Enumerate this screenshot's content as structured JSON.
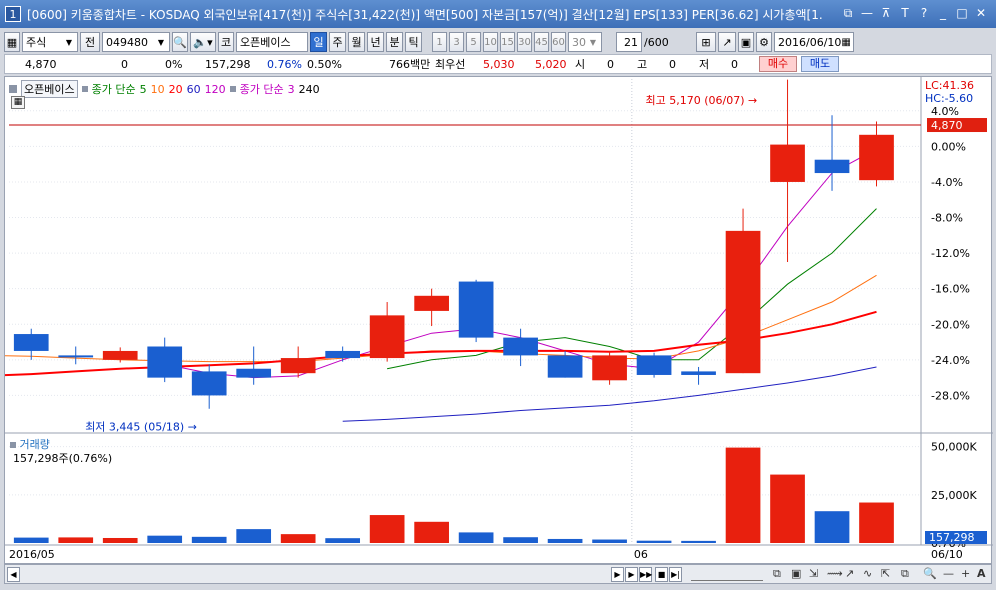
{
  "window": {
    "number": "1",
    "title": "[0600] 키움종합차트 - KOSDAQ 외국인보유[417(천)] 주식수[31,422(천)] 액면[500] 자본금[157(억)] 결산[12월] EPS[133] PER[36.62] 시가총액[1.",
    "controls": [
      "⧉",
      "—",
      "⊼",
      "T",
      "?",
      "_",
      "□",
      "✕"
    ]
  },
  "toolbar": {
    "market": "주식",
    "prev_label": "전",
    "code": "049480",
    "search_icon": "search-icon",
    "sound_icon": "speaker-icon",
    "code_label": "코",
    "stock_name": "오픈베이스",
    "periods": [
      "일",
      "주",
      "월",
      "년",
      "분",
      "틱"
    ],
    "selected_period": "일",
    "intervals": [
      "1",
      "3",
      "5",
      "10",
      "15",
      "30",
      "45",
      "60",
      "30"
    ],
    "count": "21",
    "count_total": "/600",
    "date": "2016/06/10"
  },
  "inforow": {
    "price": "4,870",
    "change": "0",
    "change_pct": "0%",
    "volume": "157,298",
    "volume_ratio": "0.76%",
    "turnover": "0.50%",
    "amount": "766백만",
    "bid_label": "최우선",
    "ask_price": "5,030",
    "bid_price": "5,020",
    "open_label": "시",
    "open_val": "0",
    "high_label": "고",
    "high_val": "0",
    "low_label": "저",
    "low_val": "0",
    "buy_label": "매수",
    "sell_label": "매도"
  },
  "legend": {
    "name": "오픈베이스",
    "ma_label": "종가 단순",
    "periods": [
      "5",
      "10",
      "20",
      "60",
      "120"
    ],
    "ma2_label": "종가 단순",
    "ma2_periods": [
      "3",
      "240"
    ]
  },
  "volume_panel": {
    "title": "거래량",
    "current": "157,298주(0.76%)",
    "current_tag": "157,298",
    "y_ticks": [
      {
        "label": "50,000K",
        "value": 50000
      },
      {
        "label": "25,000K",
        "value": 25000
      },
      {
        "label": "0.76%",
        "value": 0
      }
    ]
  },
  "chart_data": {
    "type": "candlestick",
    "x_labels": [
      "2016/05",
      "06",
      "06/10"
    ],
    "y_axis_right": [
      "4.0%",
      "0.00%",
      "-4.0%",
      "-8.0%",
      "-12.0%",
      "-16.0%",
      "-20.0%",
      "-24.0%",
      "-28.0%"
    ],
    "y_tick_values": [
      4,
      0,
      -4,
      -8,
      -12,
      -16,
      -20,
      -24,
      -28
    ],
    "lc_label": "LC:41.36",
    "hc_label": "HC:-5.60",
    "current_price_tag": "4,870",
    "high_annotation": "최고 5,170 (06/07)",
    "low_annotation": "최저 3,445 (05/18)",
    "ylim_pct": [
      -32,
      6
    ],
    "candles": [
      {
        "o": -21.1,
        "c": -23.0,
        "h": -20.5,
        "l": -24.0,
        "up": false
      },
      {
        "o": -23.5,
        "c": -23.5,
        "h": -22.5,
        "l": -24.5,
        "up": false
      },
      {
        "o": -24.0,
        "c": -23.0,
        "h": -22.6,
        "l": -24.3,
        "up": true
      },
      {
        "o": -22.5,
        "c": -26.0,
        "h": -21.5,
        "l": -26.5,
        "up": false
      },
      {
        "o": -25.3,
        "c": -28.0,
        "h": -24.5,
        "l": -29.5,
        "up": false
      },
      {
        "o": -25.0,
        "c": -26.0,
        "h": -22.5,
        "l": -26.8,
        "up": false
      },
      {
        "o": -25.5,
        "c": -23.8,
        "h": -22.5,
        "l": -26.0,
        "up": true
      },
      {
        "o": -23.0,
        "c": -23.8,
        "h": -22.5,
        "l": -24.2,
        "up": false
      },
      {
        "o": -23.8,
        "c": -19.0,
        "h": -17.5,
        "l": -24.2,
        "up": true
      },
      {
        "o": -18.5,
        "c": -16.8,
        "h": -16.0,
        "l": -20.2,
        "up": true
      },
      {
        "o": -15.2,
        "c": -21.5,
        "h": -15.0,
        "l": -22.0,
        "up": false
      },
      {
        "o": -21.5,
        "c": -23.5,
        "h": -20.5,
        "l": -24.7,
        "up": false
      },
      {
        "o": -23.5,
        "c": -26.0,
        "h": -23.0,
        "l": -26.0,
        "up": false
      },
      {
        "o": -23.5,
        "c": -26.3,
        "h": -23.0,
        "l": -26.8,
        "up": true
      },
      {
        "o": -23.5,
        "c": -25.7,
        "h": -23.2,
        "l": -26.0,
        "up": false
      },
      {
        "o": -25.3,
        "c": -25.7,
        "h": -24.8,
        "l": -26.8,
        "up": false
      },
      {
        "o": -25.5,
        "c": -9.5,
        "h": -7.0,
        "l": -25.5,
        "up": true
      },
      {
        "o": -4.0,
        "c": 0.2,
        "h": 7.5,
        "l": -13.0,
        "up": true
      },
      {
        "o": -1.5,
        "c": -3.0,
        "h": 3.5,
        "l": -5.0,
        "up": false
      },
      {
        "o": -3.8,
        "c": 1.3,
        "h": 2.8,
        "l": -4.5,
        "up": true
      }
    ],
    "volume_k": [
      2800,
      2900,
      2600,
      3800,
      3200,
      7200,
      4600,
      2500,
      14500,
      11000,
      5500,
      3000,
      2100,
      1800,
      1200,
      1100,
      49500,
      35500,
      16500,
      21000
    ],
    "volume_up": [
      false,
      true,
      true,
      false,
      false,
      false,
      true,
      false,
      true,
      true,
      false,
      false,
      false,
      false,
      false,
      false,
      true,
      true,
      false,
      true
    ],
    "volume_ylim_k": [
      0,
      55000
    ],
    "ma_series": [
      {
        "name": "5",
        "color": "#c000c0",
        "values": [
          null,
          null,
          null,
          null,
          -24.5,
          -25.5,
          -26.0,
          -25.8,
          -24.0,
          -22.5,
          -21.0,
          -20.5,
          -21.5,
          -23.0,
          -24.5,
          -25.0,
          -22.0,
          -16.0,
          -9.0,
          -3.0,
          -0.3
        ]
      },
      {
        "name": "10",
        "color": "#008000",
        "values": [
          null,
          null,
          null,
          null,
          null,
          null,
          null,
          null,
          null,
          -25.0,
          -24.0,
          -23.5,
          -22.0,
          -21.5,
          -22.5,
          -24.0,
          -24.0,
          -20.0,
          -15.5,
          -12.0,
          -7.0
        ]
      },
      {
        "name": "20",
        "color": "#ff7010",
        "values": [
          -23.5,
          -23.6,
          -23.8,
          -24.0,
          -24.1,
          -24.2,
          -24.2,
          -24.2,
          -23.8,
          -23.4,
          -23.0,
          -23.0,
          -23.3,
          -23.5,
          -23.8,
          -23.9,
          -23.0,
          -21.5,
          -19.5,
          -17.5,
          -14.5
        ]
      },
      {
        "name": "60",
        "color": "#ff0000",
        "values": [
          -25.8,
          -25.6,
          -25.3,
          -25.0,
          -24.8,
          -24.6,
          -24.4,
          -24.0,
          -23.6,
          -23.3,
          -23.1,
          -23.0,
          -23.0,
          -23.0,
          -23.1,
          -23.0,
          -22.3,
          -21.8,
          -21.0,
          -20.0,
          -18.6
        ]
      },
      {
        "name": "120",
        "color": "#2020c0",
        "values": [
          null,
          null,
          null,
          null,
          null,
          null,
          null,
          null,
          -30.9,
          -30.7,
          -30.4,
          -30.1,
          -29.7,
          -29.4,
          -29.1,
          -28.6,
          -28.0,
          -27.3,
          -26.6,
          -25.8,
          -24.8
        ]
      }
    ]
  }
}
